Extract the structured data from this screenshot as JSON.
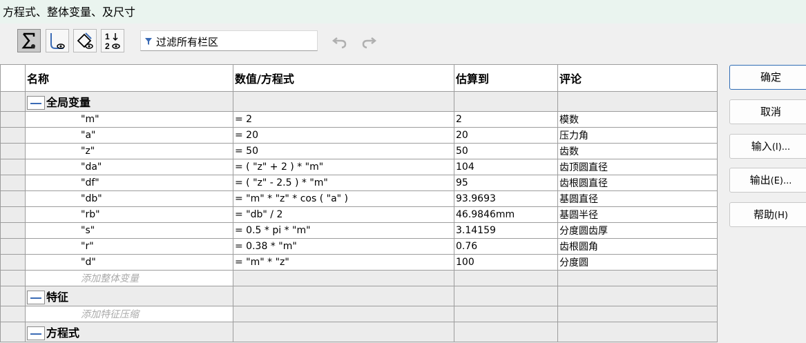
{
  "window": {
    "title": "方程式、整体变量、及尺寸"
  },
  "toolbar": {
    "buttons": [
      {
        "icon": "sigma-icon",
        "active": true
      },
      {
        "icon": "dimension-view-icon",
        "active": false
      },
      {
        "icon": "sketch-dimension-view-icon",
        "active": false
      },
      {
        "icon": "ordered-view-icon",
        "active": false
      }
    ],
    "filter_placeholder": "过滤所有栏区"
  },
  "table": {
    "columns": [
      "名称",
      "数值/方程式",
      "估算到",
      "评论"
    ],
    "groups": {
      "global": "全局变量",
      "features": "特征",
      "equations": "方程式"
    },
    "rows": [
      {
        "name": "\"m\"",
        "value": "= 2",
        "eval": "2",
        "comment": "模数"
      },
      {
        "name": "\"a\"",
        "value": "= 20",
        "eval": "20",
        "comment": "压力角"
      },
      {
        "name": "\"z\"",
        "value": "= 50",
        "eval": "50",
        "comment": "齿数"
      },
      {
        "name": "\"da\"",
        "value": "= ( \"z\" + 2 ) * \"m\"",
        "eval": "104",
        "comment": "齿顶圆直径"
      },
      {
        "name": "\"df\"",
        "value": "= ( \"z\" - 2.5 ) * \"m\"",
        "eval": "95",
        "comment": "齿根圆直径"
      },
      {
        "name": "\"db\"",
        "value": "= \"m\" * \"z\" * cos ( \"a\" )",
        "eval": "93.9693",
        "comment": "基圆直径"
      },
      {
        "name": "\"rb\"",
        "value": "= \"db\" / 2",
        "eval": "46.9846mm",
        "comment": "基圆半径"
      },
      {
        "name": "\"s\"",
        "value": "= 0.5 * pi * \"m\"",
        "eval": "3.14159",
        "comment": "分度圆齿厚"
      },
      {
        "name": "\"r\"",
        "value": "= 0.38 * \"m\"",
        "eval": "0.76",
        "comment": "齿根圆角"
      },
      {
        "name": "\"d\"",
        "value": "= \"m\" * \"z\"",
        "eval": "100",
        "comment": "分度圆"
      }
    ],
    "add_global": "添加整体变量",
    "add_feature": "添加特征压缩"
  },
  "sidebar": {
    "ok": "确定",
    "cancel": "取消",
    "import": "输入",
    "import_key": "(I)...",
    "export": "输出",
    "export_key": "(E)...",
    "help": "帮助",
    "help_key": "(H)"
  },
  "colors": {
    "accent": "#2f6db5",
    "title_bg": "#eaf4ef",
    "group_bg": "#ececec"
  }
}
